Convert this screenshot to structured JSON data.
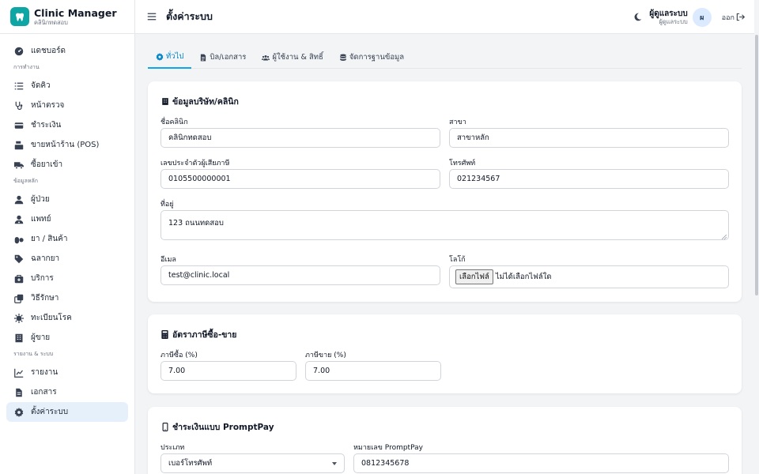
{
  "brand": {
    "title": "Clinic Manager",
    "subtitle": "คลินิกทดสอบ"
  },
  "sidebar": {
    "items_top": [
      {
        "label": "แดชบอร์ด",
        "icon": "dashboard-icon"
      }
    ],
    "section_work": "การทำงาน",
    "items_work": [
      {
        "label": "จัดคิว",
        "icon": "queue-list-icon"
      },
      {
        "label": "หน้าตรวจ",
        "icon": "stethoscope-icon"
      },
      {
        "label": "ชำระเงิน",
        "icon": "credit-card-icon"
      },
      {
        "label": "ขายหน้าร้าน (POS)",
        "icon": "cash-register-icon"
      },
      {
        "label": "ซื้อยาเข้า",
        "icon": "truck-icon"
      }
    ],
    "section_master": "ข้อมูลหลัก",
    "items_master": [
      {
        "label": "ผู้ป่วย",
        "icon": "user-icon"
      },
      {
        "label": "แพทย์",
        "icon": "doctor-icon"
      },
      {
        "label": "ยา / สินค้า",
        "icon": "pills-icon"
      },
      {
        "label": "ฉลากยา",
        "icon": "tag-icon"
      },
      {
        "label": "บริการ",
        "icon": "medkit-icon"
      },
      {
        "label": "วิธีรักษา",
        "icon": "clone-icon"
      },
      {
        "label": "ทะเบียนโรค",
        "icon": "virus-icon"
      },
      {
        "label": "ผู้ขาย",
        "icon": "building-icon"
      }
    ],
    "section_reports": "รายงาน & ระบบ",
    "items_reports": [
      {
        "label": "รายงาน",
        "icon": "chart-line-icon"
      },
      {
        "label": "เอกสาร",
        "icon": "file-icon"
      },
      {
        "label": "ตั้งค่าระบบ",
        "icon": "gear-icon"
      }
    ]
  },
  "header": {
    "title": "ตั้งค่าระบบ",
    "user_name": "ผู้ดูแลระบบ",
    "user_role": "ผู้ดูแลระบบ",
    "avatar_initial": "ผ",
    "logout": "ออก"
  },
  "tabs": [
    {
      "label": "ทั่วไป",
      "icon": "gear-icon",
      "active": true
    },
    {
      "label": "บิล/เอกสาร",
      "icon": "file-invoice-icon",
      "active": false
    },
    {
      "label": "ผู้ใช้งาน & สิทธิ์",
      "icon": "users-icon",
      "active": false
    },
    {
      "label": "จัดการฐานข้อมูล",
      "icon": "database-icon",
      "active": false
    }
  ],
  "company": {
    "title": "ข้อมูลบริษัท/คลินิก",
    "clinic_name_label": "ชื่อคลินิก",
    "clinic_name": "คลินิกทดสอบ",
    "branch_label": "สาขา",
    "branch": "สาขาหลัก",
    "tax_id_label": "เลขประจำตัวผู้เสียภาษี",
    "tax_id": "0105500000001",
    "phone_label": "โทรศัพท์",
    "phone": "021234567",
    "address_label": "ที่อยู่",
    "address": "123 ถนนทดสอบ",
    "email_label": "อีเมล",
    "email": "test@clinic.local",
    "logo_label": "โลโก้",
    "logo_button": "เลือกไฟล์",
    "logo_status": "ไม่ได้เลือกไฟล์ใด"
  },
  "tax": {
    "title": "อัตราภาษีซื้อ-ขาย",
    "purchase_label": "ภาษีซื้อ (%)",
    "purchase": "7.00",
    "sales_label": "ภาษีขาย (%)",
    "sales": "7.00"
  },
  "promptpay": {
    "title": "ชำระเงินแบบ PromptPay",
    "type_label": "ประเภท",
    "type": "เบอร์โทรศัพท์",
    "number_label": "หมายเลข PromptPay",
    "number": "0812345678"
  },
  "colors": {
    "accent": "#0284c7",
    "brand": "#0ea5a5",
    "active_nav_bg": "#e6f0fb"
  }
}
